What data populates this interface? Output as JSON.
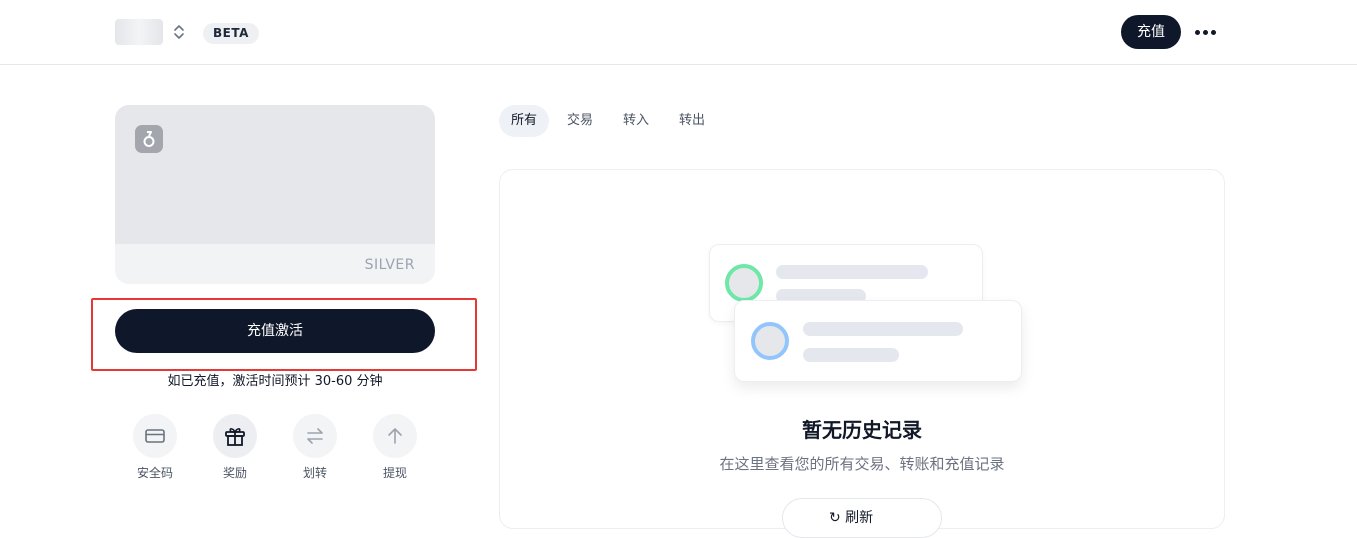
{
  "header": {
    "badge": "BETA",
    "topup_label": "充值"
  },
  "card": {
    "tier": "SILVER"
  },
  "activation": {
    "button_label": "充值激活",
    "note": "如已充值，激活时间预计 30-60 分钟"
  },
  "actions": [
    {
      "label": "安全码",
      "icon": "card-icon"
    },
    {
      "label": "奖励",
      "icon": "gift-icon"
    },
    {
      "label": "划转",
      "icon": "transfer-icon"
    },
    {
      "label": "提现",
      "icon": "arrow-up-icon"
    }
  ],
  "tabs": [
    {
      "label": "所有",
      "active": true
    },
    {
      "label": "交易",
      "active": false
    },
    {
      "label": "转入",
      "active": false
    },
    {
      "label": "转出",
      "active": false
    }
  ],
  "empty_state": {
    "title": "暂无历史记录",
    "description": "在这里查看您的所有交易、转账和充值记录",
    "button_label": "↻ 刷新"
  },
  "colors": {
    "primary": "#0f172a",
    "highlight_border": "#e53935",
    "card_bg": "#e6e7eb"
  }
}
